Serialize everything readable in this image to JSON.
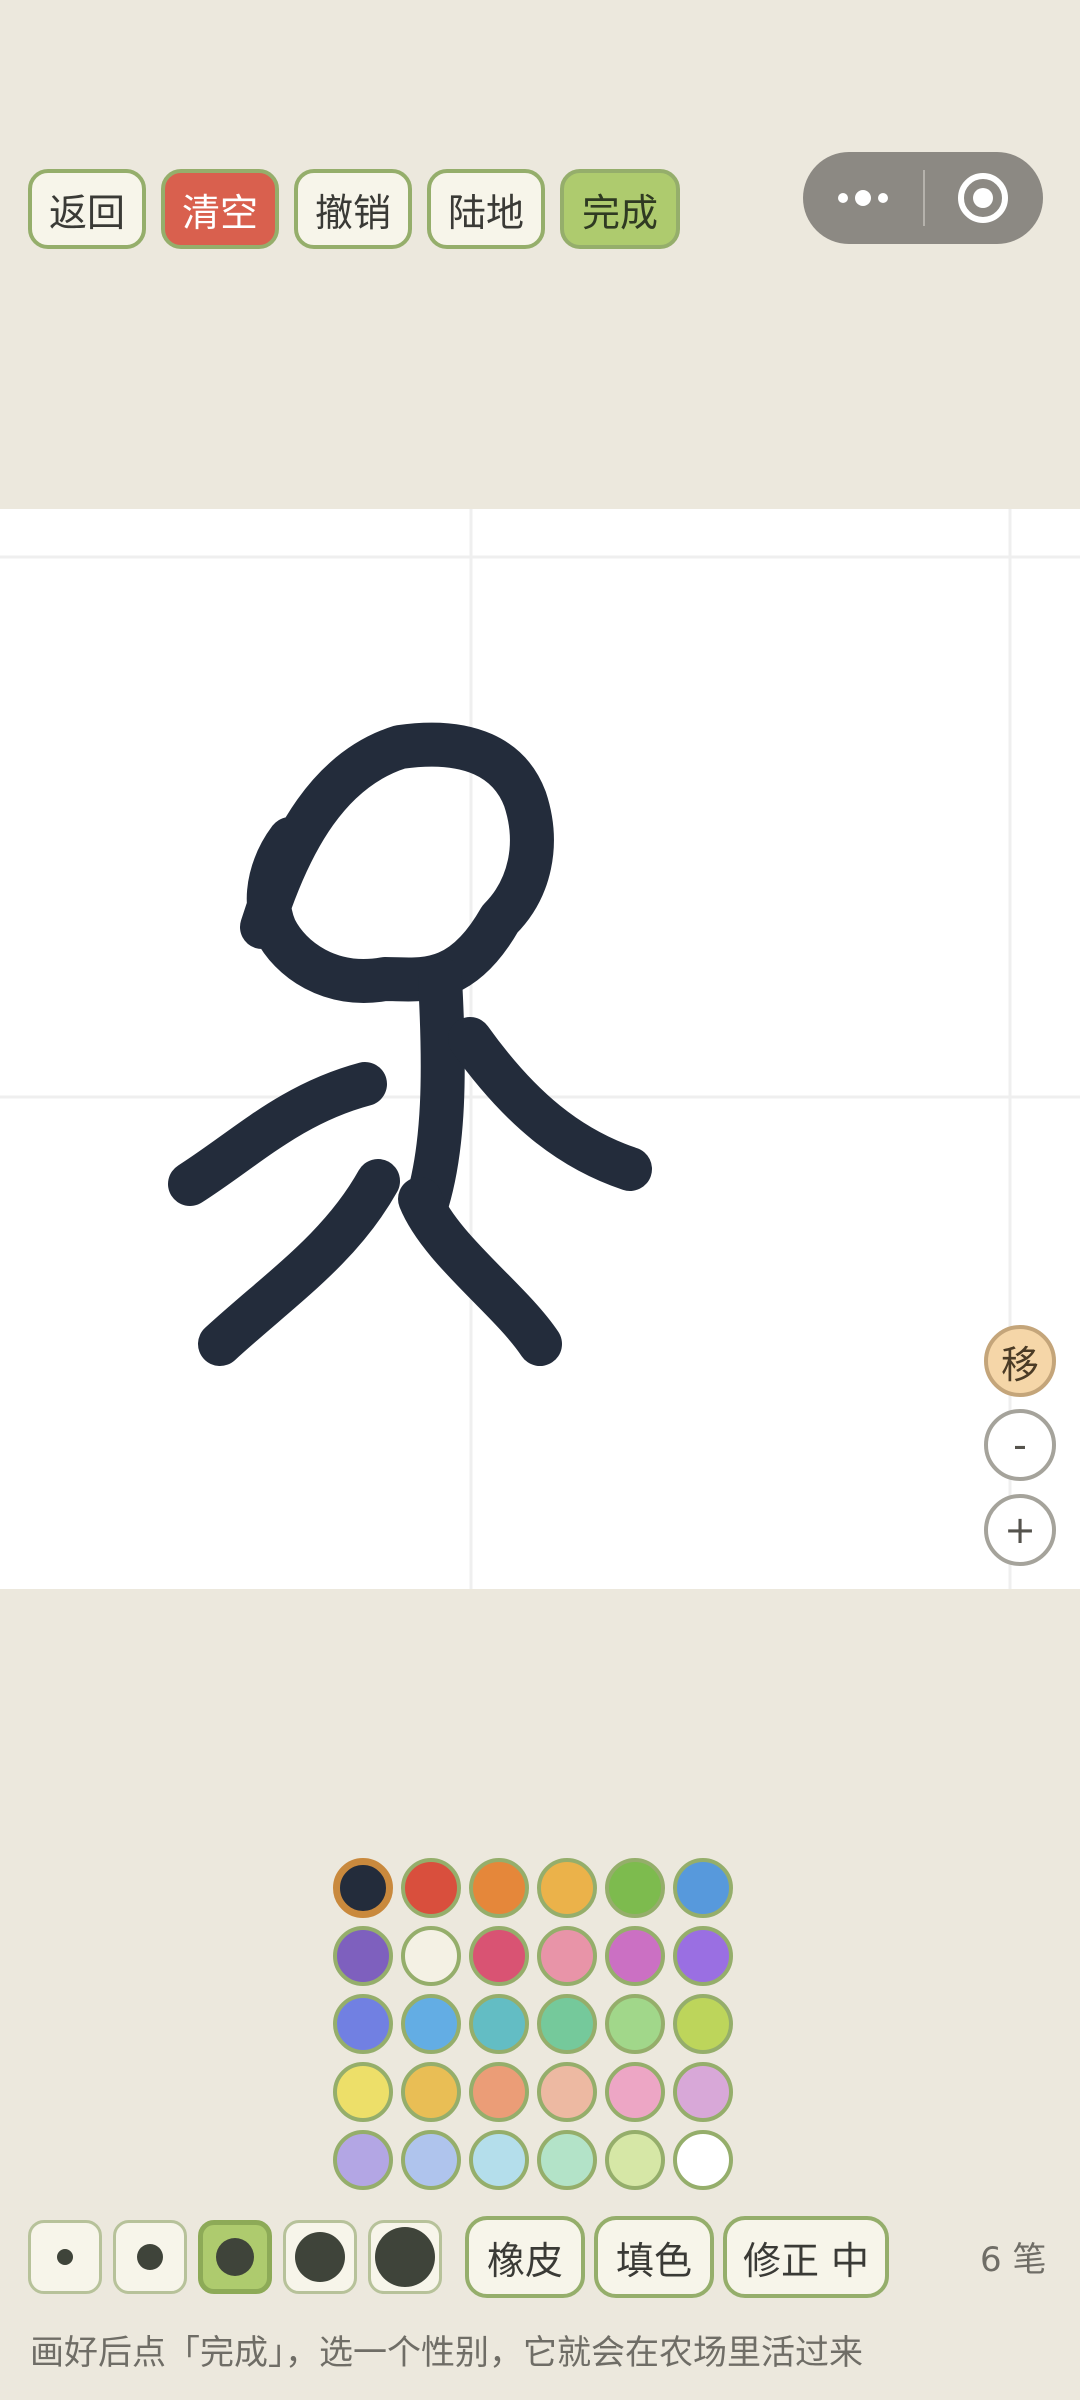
{
  "toolbar": {
    "back_label": "返回",
    "clear_label": "清空",
    "undo_label": "撤销",
    "land_label": "陆地",
    "done_label": "完成"
  },
  "capsule": {
    "more_icon": "more-dots-icon",
    "close_icon": "target-circle-icon"
  },
  "canvas": {
    "stroke_color": "#232C3B",
    "move_label": "移",
    "zoom_out_label": "-",
    "zoom_in_label": "+"
  },
  "palette": {
    "colors": [
      "#232C3B",
      "#D94F3D",
      "#E5873A",
      "#EBB24A",
      "#7DBB4E",
      "#5799DC",
      "#7E60BE",
      "#F4F1E4",
      "#D95373",
      "#E894A8",
      "#CB70C3",
      "#9A6FE2",
      "#7180E2",
      "#63ADE4",
      "#63BDC4",
      "#75C99B",
      "#A1D78A",
      "#BDD55B",
      "#EDDF69",
      "#E9BE55",
      "#EB9D77",
      "#EDB9A2",
      "#EDA6C5",
      "#D8A8D8",
      "#B3A6E4",
      "#AFC4ED",
      "#B4DEEB",
      "#B3E3C8",
      "#D6E7A6",
      "#FFFFFF"
    ],
    "selected_index": 0
  },
  "brush": {
    "sizes": [
      "xs",
      "s",
      "m",
      "l",
      "xl"
    ],
    "selected_index": 2
  },
  "tools": {
    "eraser_label": "橡皮",
    "fill_label": "填色",
    "correct_label": "修正 中"
  },
  "stroke_count": "6 笔",
  "hint": "画好后点「完成」，选一个性别，它就会在农场里活过来",
  "colors": {
    "accent": "#AECB6E",
    "danger": "#D9604E",
    "background": "#ECE8DD"
  }
}
